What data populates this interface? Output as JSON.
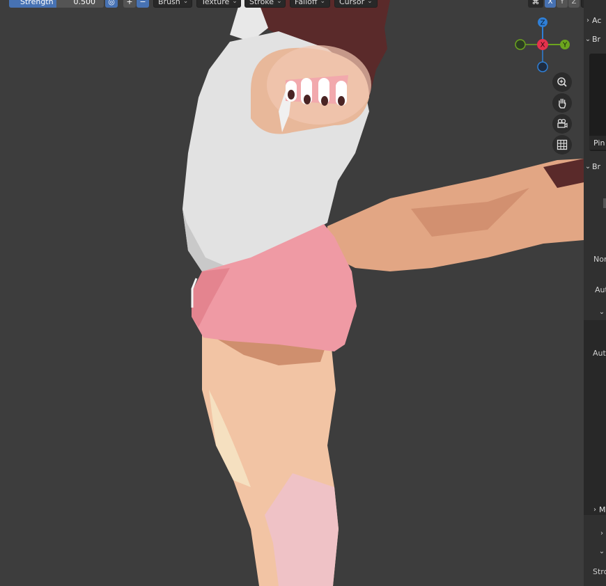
{
  "toolbar": {
    "strength_label": "Strength",
    "strength_value": "0.500",
    "strength_fraction": 0.5,
    "plus_label": "+",
    "minus_label": "−",
    "brush_label": "Brush",
    "texture_label": "Texture",
    "stroke_label": "Stroke",
    "falloff_label": "Falloff",
    "cursor_label": "Cursor",
    "axis_x": "X",
    "axis_y": "Y",
    "axis_z": "Z"
  },
  "gizmo": {
    "x_label": "X",
    "y_label": "Y",
    "z_label": "Z",
    "x_color": "#e4324d",
    "y_color": "#6ca51e",
    "z_color": "#2f7fd6"
  },
  "nav_icons": [
    "zoom-icon",
    "pan-hand-icon",
    "camera-icon",
    "grid-icon"
  ],
  "sidebar": {
    "row1": "Ac",
    "row2": "Br",
    "pin_label": "Pin",
    "row3": "Br",
    "normal_label": "Nor",
    "auto1_label": "Aut",
    "auto2_label": "Aut",
    "row_m": "M",
    "strength_label": "Stro"
  }
}
